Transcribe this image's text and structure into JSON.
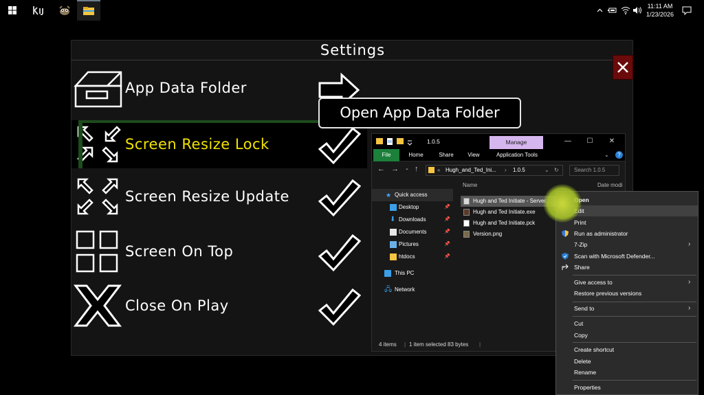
{
  "taskbar": {
    "time": "11:11 AM",
    "date": "1/23/2026"
  },
  "settings": {
    "title": "Settings",
    "close_label": "X",
    "rows": [
      {
        "label": "App Data Folder",
        "mark": "arrow"
      },
      {
        "label": "Screen Resize Lock",
        "mark": "check",
        "selected": true
      },
      {
        "label": "Screen Resize Update",
        "mark": "check"
      },
      {
        "label": "Screen On Top",
        "mark": "check"
      },
      {
        "label": "Close On Play",
        "mark": "check"
      }
    ],
    "tooltip": "Open App Data Folder",
    "colors": {
      "selected_text": "#f1e300",
      "selection_bar": "#1d4c1d",
      "close_bg": "#6b0a0a"
    }
  },
  "explorer": {
    "title": "1.0.5",
    "manage": "Manage",
    "tabs": [
      "File",
      "Home",
      "Share",
      "View",
      "Application Tools"
    ],
    "address": [
      "«",
      "Hugh_and_Ted_Ini...",
      "›",
      "1.0.5"
    ],
    "search_placeholder": "Search 1.0.5",
    "nav": {
      "quick_access": "Quick access",
      "items": [
        "Desktop",
        "Downloads",
        "Documents",
        "Pictures",
        "htdocs"
      ],
      "this_pc": "This PC",
      "network": "Network"
    },
    "columns": {
      "name": "Name",
      "date": "Date modi"
    },
    "files": [
      "Hugh and Ted Initiate - Server...",
      "Hugh and Ted Initiate.exe",
      "Hugh and Ted Initiate.pck",
      "Version.png"
    ],
    "status": {
      "items": "4 items",
      "selected": "1 item selected  83 bytes"
    }
  },
  "context_menu": {
    "items": [
      {
        "label": "Open"
      },
      {
        "label": "Edit"
      },
      {
        "label": "Print"
      },
      {
        "label": "Run as administrator"
      },
      {
        "label": "7-Zip"
      },
      {
        "label": "Scan with Microsoft Defender..."
      },
      {
        "label": "Share"
      },
      {
        "label": "Give access to"
      },
      {
        "label": "Restore previous versions"
      },
      {
        "label": "Send to"
      },
      {
        "label": "Cut"
      },
      {
        "label": "Copy"
      },
      {
        "label": "Create shortcut"
      },
      {
        "label": "Delete"
      },
      {
        "label": "Rename"
      },
      {
        "label": "Properties"
      }
    ]
  }
}
